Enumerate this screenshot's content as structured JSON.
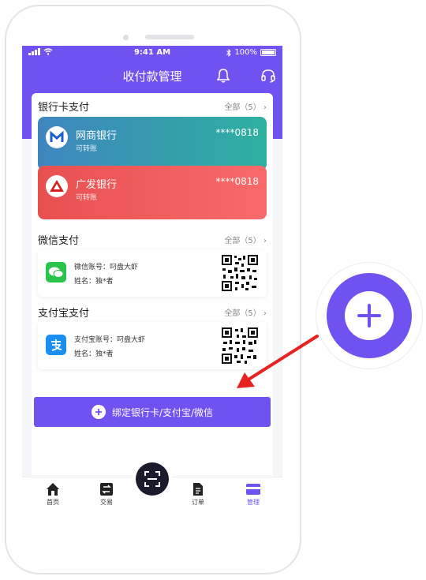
{
  "status_bar": {
    "time": "9:41 AM",
    "battery": "100%"
  },
  "header": {
    "title": "收付款管理"
  },
  "bank_section": {
    "title": "银行卡支付",
    "more": "全部（5）",
    "cards": [
      {
        "name": "网商银行",
        "sub": "可转账",
        "number": "****0818"
      },
      {
        "name": "广发银行",
        "sub": "可转账",
        "number": "****0818"
      }
    ]
  },
  "wechat_section": {
    "title": "微信支付",
    "more": "全部（5）",
    "account": "微信账号：叼盘大虾",
    "name": "姓名：独*者"
  },
  "alipay_section": {
    "title": "支付宝支付",
    "more": "全部（5）",
    "account": "支付宝账号：叼盘大虾",
    "name": "姓名：独*者"
  },
  "bind_button": {
    "label": "绑定银行卡/支付宝/微信"
  },
  "tabbar": {
    "items": [
      {
        "label": "首页"
      },
      {
        "label": "交易"
      },
      {
        "label": "订单"
      },
      {
        "label": "管理"
      }
    ]
  },
  "colors": {
    "accent": "#7052f0",
    "active_tab": "#7052f0",
    "arrow": "#e82121"
  }
}
